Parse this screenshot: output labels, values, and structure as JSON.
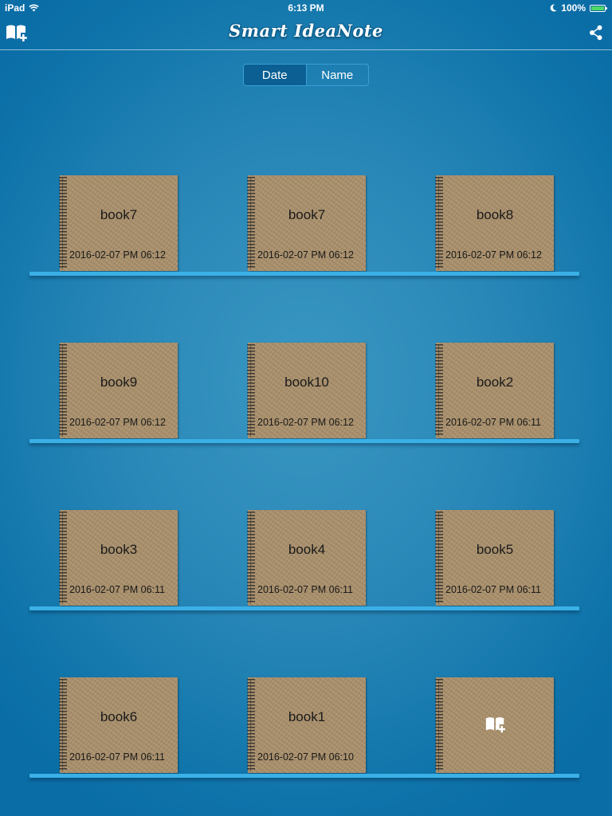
{
  "status_bar": {
    "device": "iPad",
    "time": "6:13 PM",
    "battery": "100%"
  },
  "nav": {
    "title": "Smart IdeaNote",
    "left_icon": "add-book-icon",
    "right_icon": "share-icon"
  },
  "sort": {
    "options": [
      "Date",
      "Name"
    ],
    "selected": "Date"
  },
  "books": [
    {
      "title": "book7",
      "date": "2016-02-07 PM 06:12"
    },
    {
      "title": "book7",
      "date": "2016-02-07 PM 06:12"
    },
    {
      "title": "book8",
      "date": "2016-02-07 PM 06:12"
    },
    {
      "title": "book9",
      "date": "2016-02-07 PM 06:12"
    },
    {
      "title": "book10",
      "date": "2016-02-07 PM 06:12"
    },
    {
      "title": "book2",
      "date": "2016-02-07 PM 06:11"
    },
    {
      "title": "book3",
      "date": "2016-02-07 PM 06:11"
    },
    {
      "title": "book4",
      "date": "2016-02-07 PM 06:11"
    },
    {
      "title": "book5",
      "date": "2016-02-07 PM 06:11"
    },
    {
      "title": "book6",
      "date": "2016-02-07 PM 06:11"
    },
    {
      "title": "book1",
      "date": "2016-02-07 PM 06:10"
    }
  ],
  "add_book_tile": {
    "icon": "add-book-icon"
  },
  "colors": {
    "background": "#1a7fb4",
    "shelf": "#3ab0e6",
    "cover": "#a88e69",
    "segment_active": "#0b5f92",
    "battery": "#4cd964"
  }
}
